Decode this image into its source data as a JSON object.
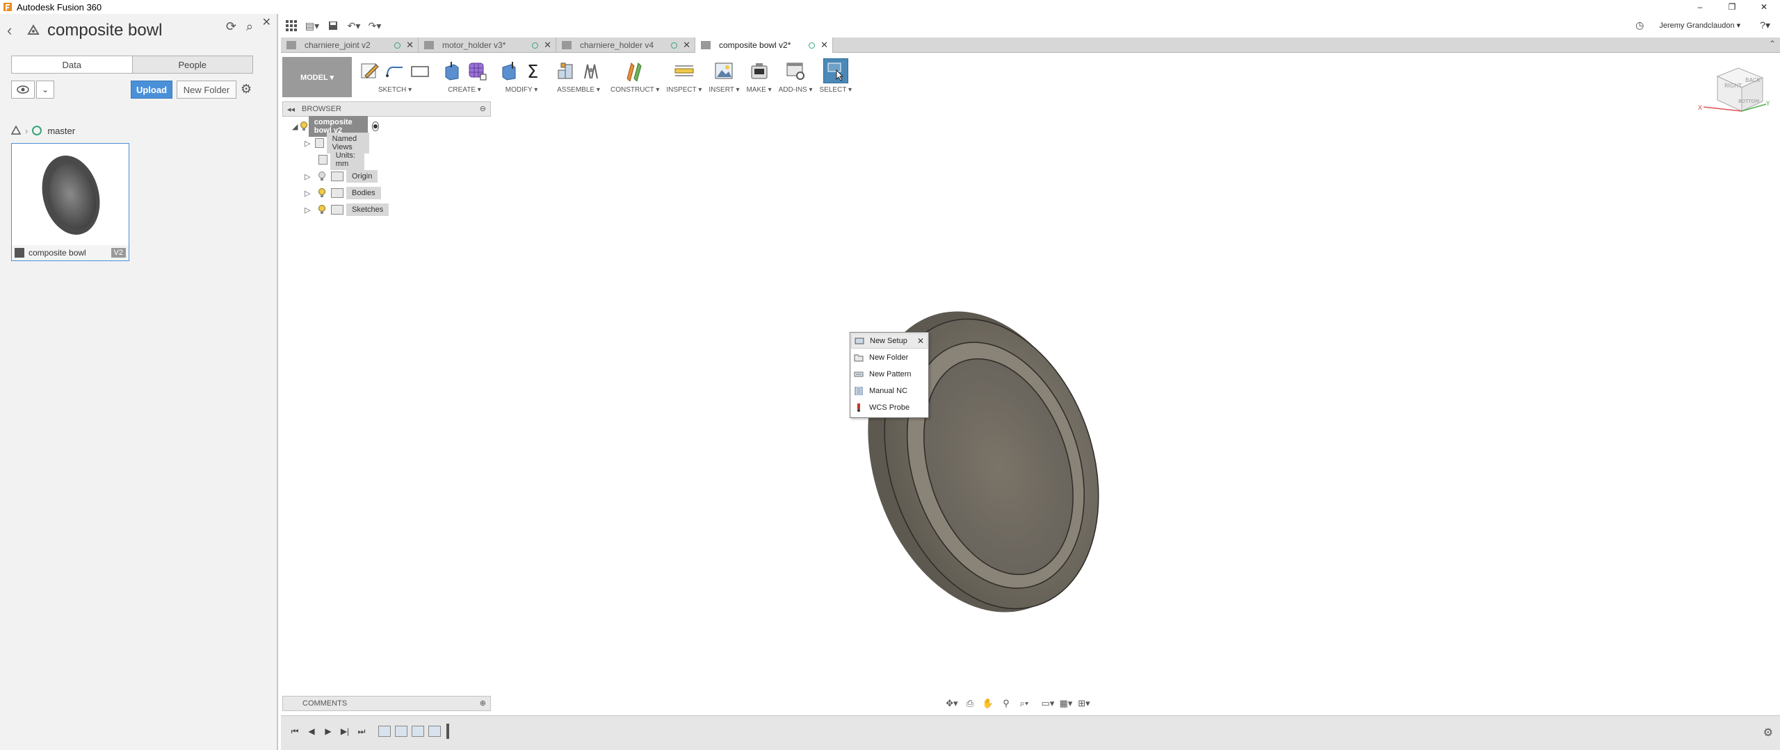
{
  "window": {
    "title": "Autodesk Fusion 360",
    "controls": [
      "–",
      "❐",
      "✕"
    ]
  },
  "datapanel": {
    "project_title": "composite bowl",
    "tabs": [
      {
        "label": "Data",
        "active": true
      },
      {
        "label": "People",
        "active": false
      }
    ],
    "upload_label": "Upload",
    "new_folder_label": "New Folder",
    "breadcrumb_branch": "master",
    "thumbnail": {
      "name": "composite bowl",
      "version": "V2"
    }
  },
  "doc_tabs": [
    {
      "label": "charniere_joint v2",
      "active": false
    },
    {
      "label": "motor_holder v3*",
      "active": false
    },
    {
      "label": "charniere_holder v4",
      "active": false
    },
    {
      "label": "composite bowl v2*",
      "active": true
    }
  ],
  "user": {
    "name": "Jeremy Grandclaudon ▾",
    "help": "?▾"
  },
  "ribbon": {
    "workspace": "MODEL ▾",
    "groups": [
      {
        "label": "SKETCH ▾"
      },
      {
        "label": "CREATE ▾"
      },
      {
        "label": "MODIFY ▾"
      },
      {
        "label": "ASSEMBLE ▾"
      },
      {
        "label": "CONSTRUCT ▾"
      },
      {
        "label": "INSPECT ▾"
      },
      {
        "label": "INSERT ▾"
      },
      {
        "label": "MAKE ▾"
      },
      {
        "label": "ADD-INS ▾"
      },
      {
        "label": "SELECT ▾"
      }
    ]
  },
  "browser": {
    "title": "BROWSER",
    "root": "composite bowl v2",
    "items": [
      {
        "label": "Named Views"
      },
      {
        "label": "Units: mm"
      },
      {
        "label": "Origin"
      },
      {
        "label": "Bodies"
      },
      {
        "label": "Sketches"
      }
    ]
  },
  "context_menu": {
    "items": [
      {
        "label": "New Setup",
        "icon": "setup-icon"
      },
      {
        "label": "New Folder",
        "icon": "folder-icon"
      },
      {
        "label": "New Pattern",
        "icon": "pattern-icon"
      },
      {
        "label": "Manual NC",
        "icon": "manual-nc-icon"
      },
      {
        "label": "WCS Probe",
        "icon": "probe-icon"
      }
    ]
  },
  "comments": {
    "title": "COMMENTS"
  },
  "viewcube": {
    "labels": [
      "RIGHT",
      "BACK",
      "BOTTOM"
    ]
  },
  "colors": {
    "accent": "#4a90d9",
    "select_active": "#4a89b8",
    "workspace_button": "#9a9a9a",
    "panel_bg": "#f2f2f2",
    "branch": "#3aa37a"
  }
}
